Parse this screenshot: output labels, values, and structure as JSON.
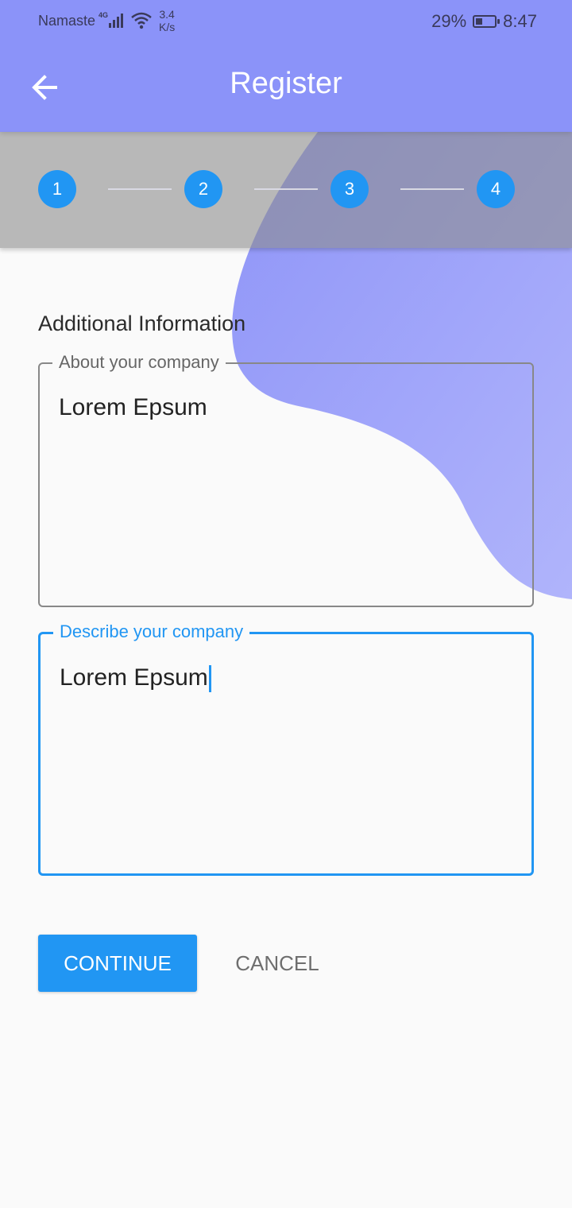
{
  "status_bar": {
    "carrier": "Namaste",
    "network": "4G",
    "speed_value": "3.4",
    "speed_unit": "K/s",
    "battery": "29%",
    "time": "8:47",
    "icons": [
      "signal-icon",
      "wifi-icon",
      "battery-charging-icon"
    ]
  },
  "app_bar": {
    "title": "Register",
    "back_icon": "arrow-back-icon",
    "background": "#8b93f9"
  },
  "stepper": {
    "steps": [
      "1",
      "2",
      "3",
      "4"
    ],
    "step_color": "#2196f3"
  },
  "form": {
    "section_title": "Additional Information",
    "about": {
      "label": "About your company",
      "value": "Lorem Epsum"
    },
    "describe": {
      "label": "Describe your company",
      "value": "Lorem Epsum",
      "focused": true
    }
  },
  "actions": {
    "continue_label": "CONTINUE",
    "cancel_label": "CANCEL"
  },
  "colors": {
    "accent": "#2196f3",
    "blob": "#9aa0f8"
  }
}
